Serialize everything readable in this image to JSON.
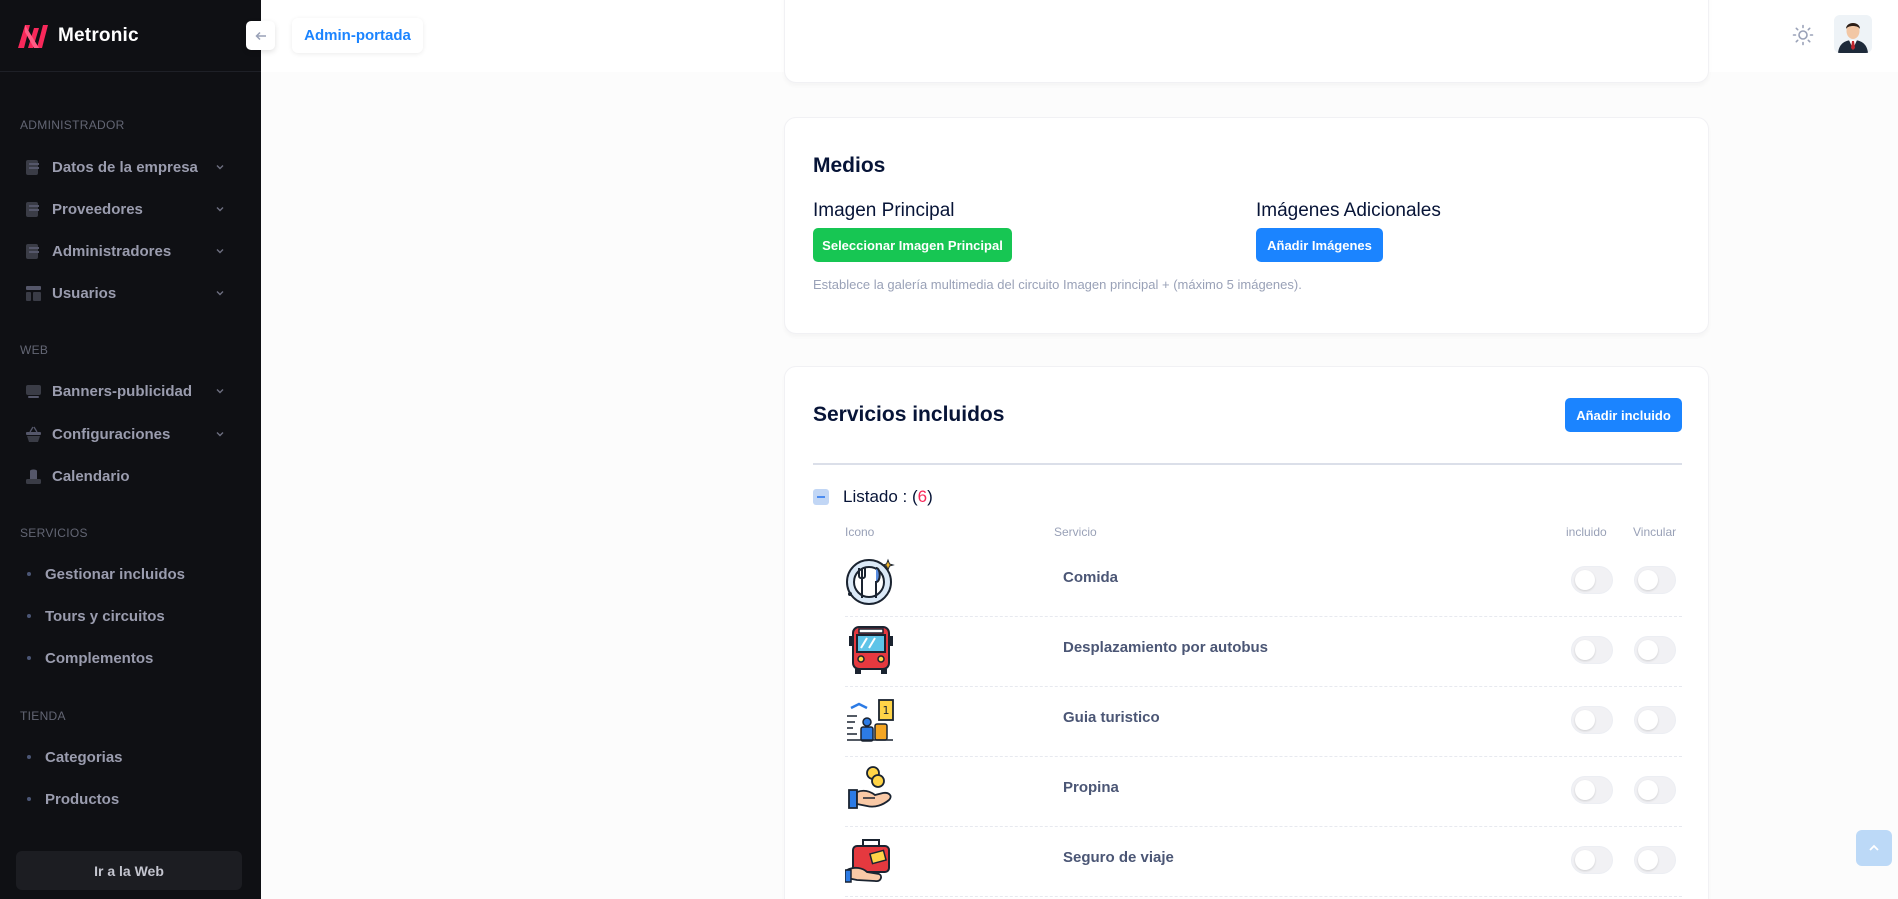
{
  "brand": {
    "name": "Metronic"
  },
  "sidebar": {
    "sections": [
      {
        "title": "ADMINISTRADOR"
      },
      {
        "title": "WEB"
      },
      {
        "title": "SERVICIOS"
      },
      {
        "title": "TIENDA"
      }
    ],
    "admin_items": [
      {
        "label": "Datos de la empresa",
        "icon": "document-icon"
      },
      {
        "label": "Proveedores",
        "icon": "document-icon"
      },
      {
        "label": "Administradores",
        "icon": "document-icon"
      },
      {
        "label": "Usuarios",
        "icon": "layout-icon"
      }
    ],
    "web_items": [
      {
        "label": "Banners-publicidad",
        "icon": "banner-icon"
      },
      {
        "label": "Configuraciones",
        "icon": "basket-icon"
      },
      {
        "label": "Calendario",
        "icon": "calendar-icon"
      }
    ],
    "services_items": [
      {
        "label": "Gestionar incluidos"
      },
      {
        "label": "Tours y circuitos"
      },
      {
        "label": "Complementos"
      }
    ],
    "store_items": [
      {
        "label": "Categorias"
      },
      {
        "label": "Productos"
      }
    ],
    "footer_button": "Ir a la Web"
  },
  "header": {
    "breadcrumb": "Admin-portada",
    "toggle_icon": "arrow-left-icon",
    "theme_icon": "sun-icon"
  },
  "media": {
    "title": "Medios",
    "main_image_title": "Imagen Principal",
    "main_image_button": "Seleccionar Imagen Principal",
    "additional_title": "Imágenes Adicionales",
    "additional_button": "Añadir Imágenes",
    "hint": "Establece la galería multimedia del circuito Imagen principal + (máximo 5 imágenes)."
  },
  "services": {
    "title": "Servicios incluidos",
    "add_button": "Añadir incluido",
    "list_label": "Listado : (",
    "list_count": "6",
    "list_close": ")",
    "columns": {
      "icon": "Icono",
      "service": "Servicio",
      "included": "incluido",
      "link": "Vincular"
    },
    "rows": [
      {
        "name": "Comida",
        "icon": "dinner-plate-icon",
        "included": false,
        "linked": false
      },
      {
        "name": "Desplazamiento por autobus",
        "icon": "bus-icon",
        "included": false,
        "linked": false
      },
      {
        "name": "Guia turistico",
        "icon": "tourist-guide-icon",
        "included": false,
        "linked": false
      },
      {
        "name": "Propina",
        "icon": "tip-hand-coins-icon",
        "included": false,
        "linked": false
      },
      {
        "name": "Seguro de viaje",
        "icon": "travel-insurance-icon",
        "included": false,
        "linked": false
      }
    ]
  },
  "colors": {
    "sidebar_bg": "#0f1014",
    "primary": "#1b84ff",
    "success": "#17c653",
    "danger": "#f8285a"
  }
}
